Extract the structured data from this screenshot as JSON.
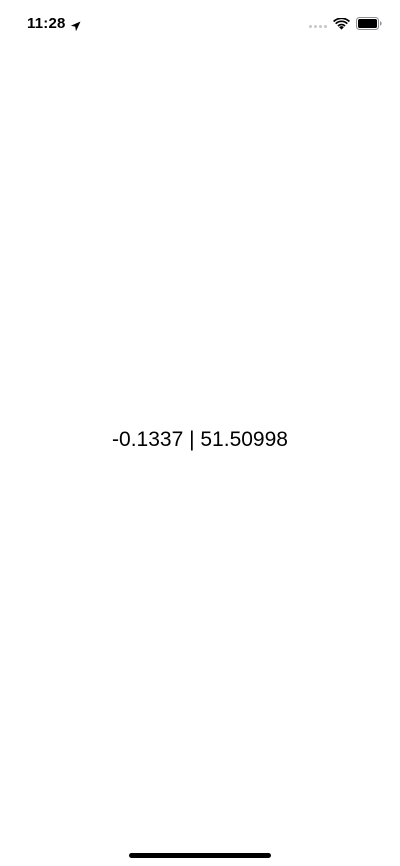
{
  "status_bar": {
    "time": "11:28",
    "location_icon": "location-arrow-icon",
    "signal_icon": "cellular-no-service-icon",
    "wifi_icon": "wifi-icon",
    "battery_icon": "battery-full-icon"
  },
  "main": {
    "coordinates_text": "-0.1337 | 51.50998"
  },
  "colors": {
    "background": "#ffffff",
    "text": "#000000",
    "inactive_signal": "#c7c7cc"
  }
}
